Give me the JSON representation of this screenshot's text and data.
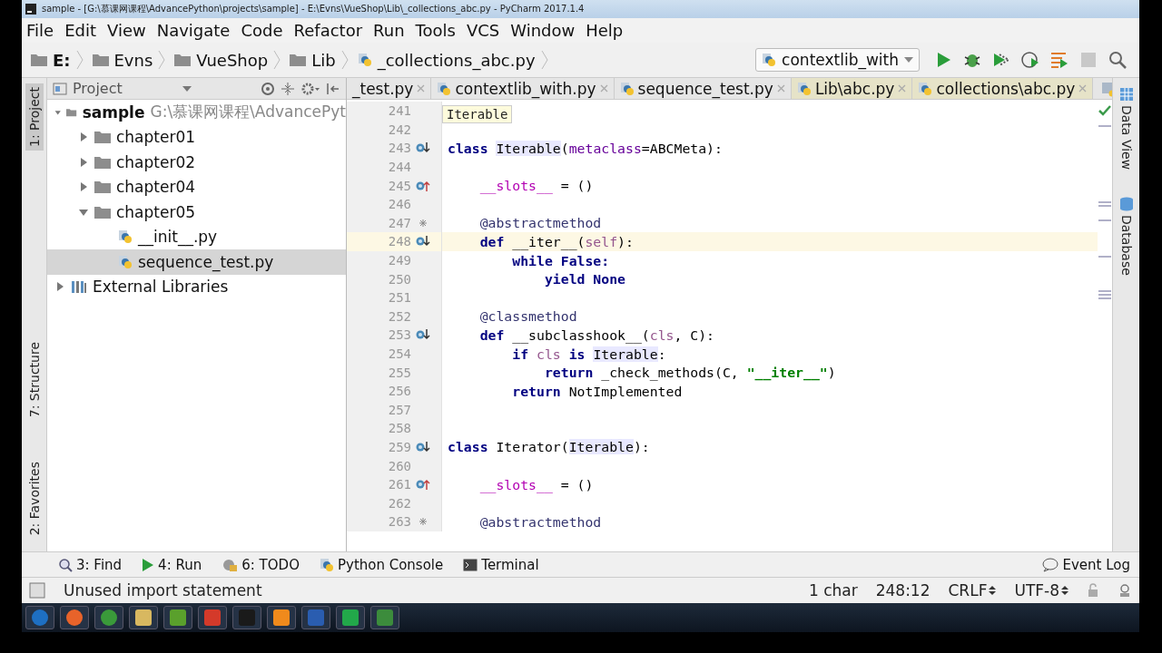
{
  "window": {
    "title": "sample - [G:\\慕课网课程\\AdvancePython\\projects\\sample] - E:\\Evns\\VueShop\\Lib\\_collections_abc.py - PyCharm 2017.1.4"
  },
  "menu": [
    "File",
    "Edit",
    "View",
    "Navigate",
    "Code",
    "Refactor",
    "Run",
    "Tools",
    "VCS",
    "Window",
    "Help"
  ],
  "breadcrumbs": [
    {
      "label": "E:",
      "kind": "drive"
    },
    {
      "label": "Evns",
      "kind": "folder"
    },
    {
      "label": "VueShop",
      "kind": "folder"
    },
    {
      "label": "Lib",
      "kind": "folder"
    },
    {
      "label": "_collections_abc.py",
      "kind": "file"
    }
  ],
  "run_config": "contextlib_with",
  "left_strip": [
    {
      "label": "1: Project",
      "selected": true
    },
    {
      "label": "7: Structure",
      "selected": false
    },
    {
      "label": "2: Favorites",
      "selected": false
    }
  ],
  "project": {
    "title": "Project",
    "tree": [
      {
        "label": "sample",
        "path": "G:\\慕课网课程\\AdvancePyt",
        "kind": "folder",
        "expanded": true,
        "selected": false,
        "children": [
          {
            "label": "chapter01",
            "kind": "folder",
            "expanded": false,
            "selected": false
          },
          {
            "label": "chapter02",
            "kind": "folder",
            "expanded": false,
            "selected": false
          },
          {
            "label": "chapter04",
            "kind": "folder",
            "expanded": false,
            "selected": false
          },
          {
            "label": "chapter05",
            "kind": "folder",
            "expanded": true,
            "selected": false,
            "children": [
              {
                "label": "__init__.py",
                "kind": "python",
                "selected": false
              },
              {
                "label": "sequence_test.py",
                "kind": "python",
                "selected": true
              }
            ]
          }
        ]
      },
      {
        "label": "External Libraries",
        "kind": "library",
        "expanded": false,
        "selected": false
      }
    ]
  },
  "tabs": [
    {
      "label": "_test.py",
      "library": false
    },
    {
      "label": "contextlib_with.py",
      "library": false
    },
    {
      "label": "sequence_test.py",
      "library": false
    },
    {
      "label": "Lib\\abc.py",
      "library": true
    },
    {
      "label": "collections\\abc.py",
      "library": true
    }
  ],
  "tooltip": "Iterable",
  "code": [
    {
      "num": "241",
      "current": false
    },
    {
      "num": "242",
      "current": false
    },
    {
      "num": "243",
      "kind": "implemented",
      "current": false,
      "tokens": [
        {
          "text": "class ",
          "kind": "keyword"
        },
        {
          "text": "Iterable",
          "kind": "reference"
        },
        {
          "text": "(",
          "kind": "plain"
        },
        {
          "text": "metaclass",
          "kind": "parameter"
        },
        {
          "text": "=ABCMeta):",
          "kind": "plain"
        }
      ]
    },
    {
      "num": "244",
      "current": false
    },
    {
      "num": "245",
      "kind": "overrides",
      "current": false,
      "tokens": [
        {
          "text": "    __slots__",
          "kind": "magic"
        },
        {
          "text": " = ()",
          "kind": "plain"
        }
      ]
    },
    {
      "num": "246",
      "current": false
    },
    {
      "num": "247",
      "kind": "abstract",
      "current": false,
      "tokens": [
        {
          "text": "    @abstractmethod",
          "kind": "decorator"
        }
      ]
    },
    {
      "num": "248",
      "kind": "implemented",
      "current": true,
      "tokens": [
        {
          "text": "    def",
          "kind": "keyword"
        },
        {
          "text": " __iter__(",
          "kind": "plain"
        },
        {
          "text": "self",
          "kind": "self"
        },
        {
          "text": "):",
          "kind": "plain"
        }
      ]
    },
    {
      "num": "249",
      "current": false,
      "tokens": [
        {
          "text": "        while False:",
          "kind": "keyword"
        }
      ]
    },
    {
      "num": "250",
      "current": false,
      "tokens": [
        {
          "text": "            yield None",
          "kind": "keyword"
        }
      ]
    },
    {
      "num": "251",
      "current": false
    },
    {
      "num": "252",
      "current": false,
      "tokens": [
        {
          "text": "    @classmethod",
          "kind": "decorator"
        }
      ]
    },
    {
      "num": "253",
      "kind": "implemented",
      "current": false,
      "tokens": [
        {
          "text": "    def",
          "kind": "keyword"
        },
        {
          "text": " __subclasshook__(",
          "kind": "plain"
        },
        {
          "text": "cls",
          "kind": "self"
        },
        {
          "text": ", C):",
          "kind": "plain"
        }
      ]
    },
    {
      "num": "254",
      "current": false,
      "tokens": [
        {
          "text": "        if ",
          "kind": "keyword"
        },
        {
          "text": "cls ",
          "kind": "self"
        },
        {
          "text": "is ",
          "kind": "keyword"
        },
        {
          "text": "Iterable",
          "kind": "reference"
        },
        {
          "text": ":",
          "kind": "plain"
        }
      ]
    },
    {
      "num": "255",
      "current": false,
      "tokens": [
        {
          "text": "            return",
          "kind": "keyword"
        },
        {
          "text": " _check_methods(C, ",
          "kind": "plain"
        },
        {
          "text": "\"__iter__\"",
          "kind": "string"
        },
        {
          "text": ")",
          "kind": "plain"
        }
      ]
    },
    {
      "num": "256",
      "current": false,
      "tokens": [
        {
          "text": "        return",
          "kind": "keyword"
        },
        {
          "text": " NotImplemented",
          "kind": "plain"
        }
      ]
    },
    {
      "num": "257",
      "current": false
    },
    {
      "num": "258",
      "current": false
    },
    {
      "num": "259",
      "kind": "implemented",
      "current": false,
      "tokens": [
        {
          "text": "class",
          "kind": "keyword"
        },
        {
          "text": " Iterator(",
          "kind": "plain"
        },
        {
          "text": "Iterable",
          "kind": "reference"
        },
        {
          "text": "):",
          "kind": "plain"
        }
      ]
    },
    {
      "num": "260",
      "current": false
    },
    {
      "num": "261",
      "kind": "overrides",
      "current": false,
      "tokens": [
        {
          "text": "    __slots__",
          "kind": "magic"
        },
        {
          "text": " = ()",
          "kind": "plain"
        }
      ]
    },
    {
      "num": "262",
      "current": false
    },
    {
      "num": "263",
      "kind": "abstract",
      "current": false,
      "tokens": [
        {
          "text": "    @abstractmethod",
          "kind": "decorator"
        }
      ]
    }
  ],
  "right_strip": [
    {
      "label": "Data View",
      "kind": "grid"
    },
    {
      "label": "Database",
      "kind": "db"
    }
  ],
  "tool_windows": [
    {
      "label": "3: Find",
      "kind": "find"
    },
    {
      "label": "4: Run",
      "kind": "run"
    },
    {
      "label": "6: TODO",
      "kind": "todo"
    },
    {
      "label": "Python Console",
      "kind": "console"
    },
    {
      "label": "Terminal",
      "kind": "terminal"
    }
  ],
  "event_log": "Event Log",
  "status": {
    "message": "Unused import statement",
    "selection": "1 char",
    "position": "248:12",
    "line_sep": "CRLF",
    "encoding": "UTF-8"
  },
  "taskbar": [
    {
      "color": "#1e6fc2"
    },
    {
      "color": "#e8632a"
    },
    {
      "color": "#3a9a3a"
    },
    {
      "color": "#d8b860"
    },
    {
      "color": "#5aa02c"
    },
    {
      "color": "#d43a2a"
    },
    {
      "color": "#1a1a1a"
    },
    {
      "color": "#f08a1c"
    },
    {
      "color": "#2a5db0"
    },
    {
      "color": "#22a84a"
    },
    {
      "color": "#3c8c3c"
    }
  ]
}
